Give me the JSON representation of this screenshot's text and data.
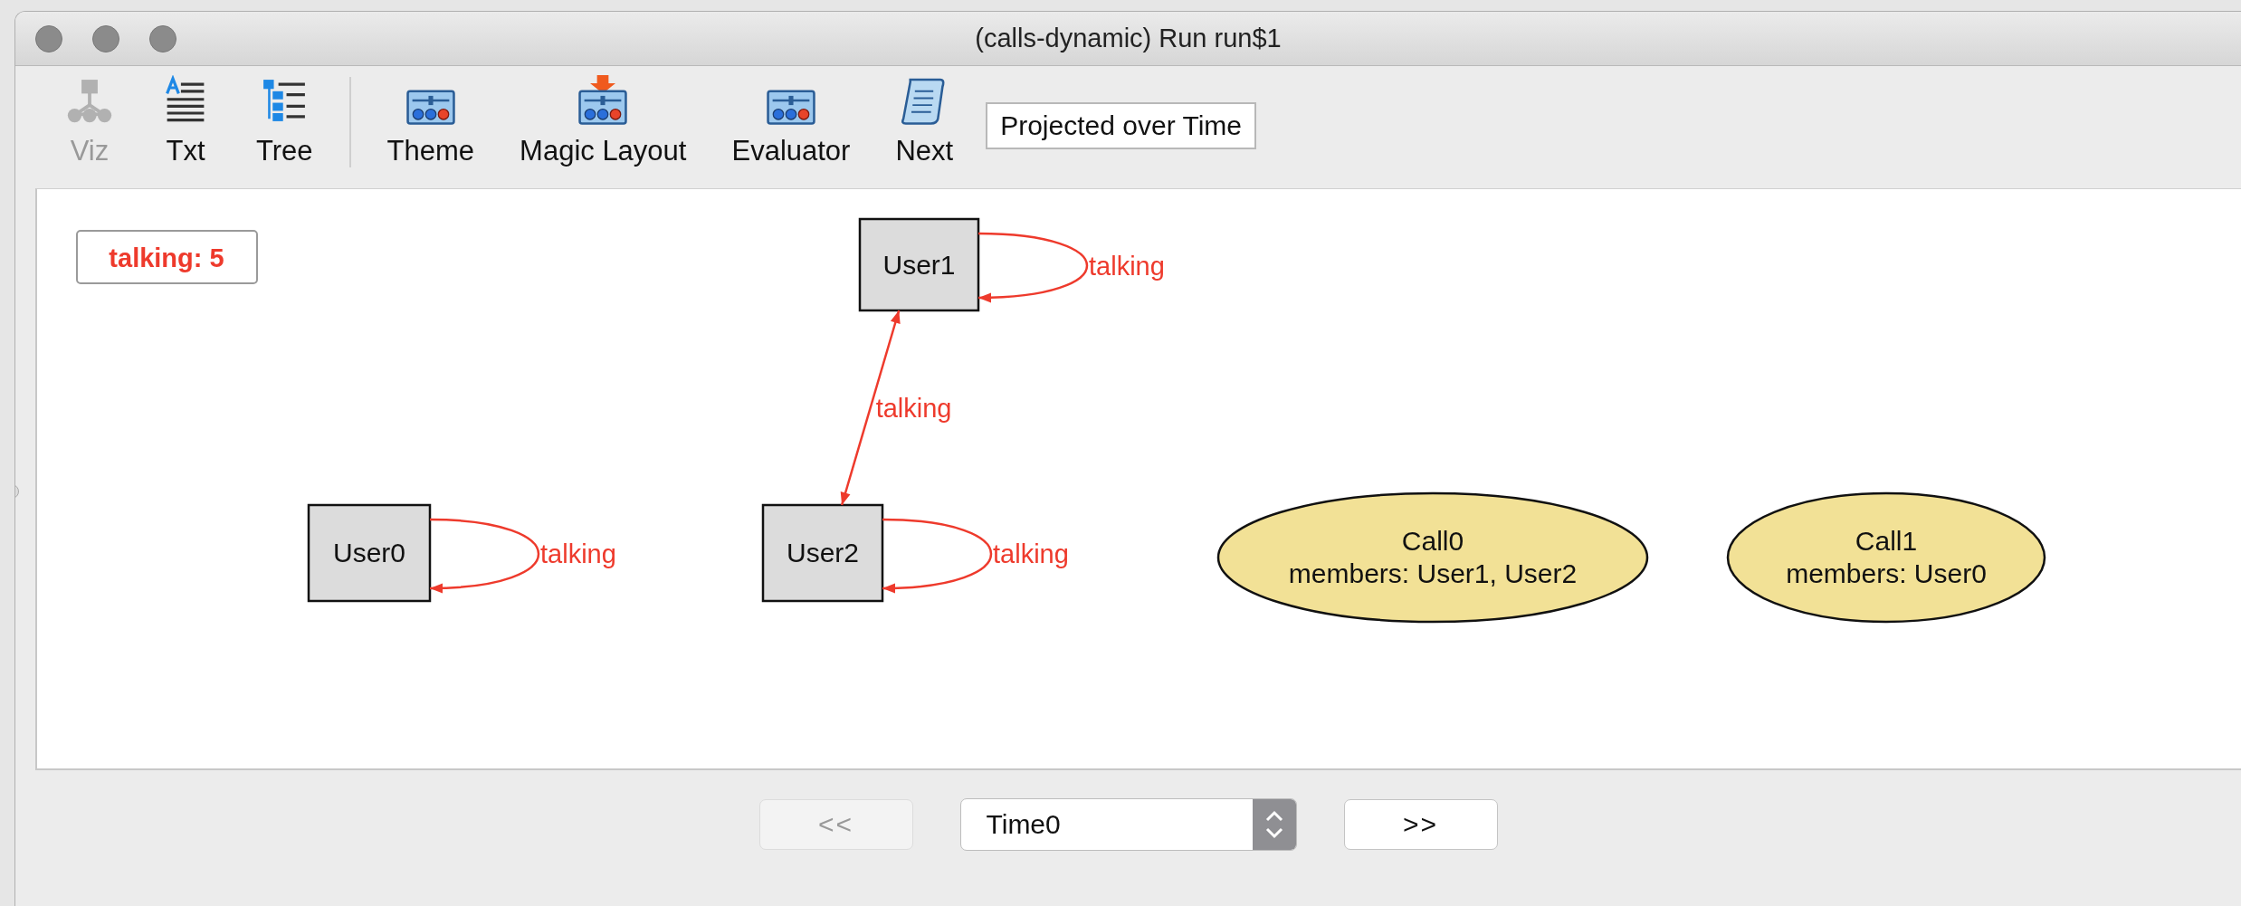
{
  "window": {
    "title": "(calls-dynamic) Run run$1"
  },
  "toolbar": {
    "view_buttons": [
      {
        "kind": "viz",
        "label": "Viz",
        "disabled": true
      },
      {
        "kind": "txt",
        "label": "Txt",
        "disabled": false
      },
      {
        "kind": "tree",
        "label": "Tree",
        "disabled": false
      }
    ],
    "action_buttons": [
      {
        "kind": "panel",
        "label": "Theme",
        "disabled": false
      },
      {
        "kind": "drop",
        "label": "Magic Layout",
        "disabled": false
      },
      {
        "kind": "panel",
        "label": "Evaluator",
        "disabled": false
      },
      {
        "kind": "scroll",
        "label": "Next",
        "disabled": false
      }
    ],
    "projection_button": {
      "label": "Projected over Time"
    }
  },
  "graph": {
    "legend": "talking: 5",
    "nodes": [
      {
        "kind": "box",
        "lines": [
          "User1"
        ]
      },
      {
        "kind": "box",
        "lines": [
          "User0"
        ]
      },
      {
        "kind": "box",
        "lines": [
          "User2"
        ]
      },
      {
        "kind": "ellipse",
        "lines": [
          "Call0",
          "members: User1, User2"
        ]
      },
      {
        "kind": "ellipse",
        "lines": [
          "Call1",
          "members: User0"
        ]
      }
    ],
    "edges": [
      {
        "kind": "loop",
        "label": "talking"
      },
      {
        "kind": "link",
        "label": "talking"
      },
      {
        "kind": "loop",
        "label": "talking"
      },
      {
        "kind": "loop",
        "label": "talking"
      }
    ]
  },
  "navigation": {
    "previous": {
      "label": "<<",
      "disabled": true
    },
    "time": {
      "value": "Time0"
    },
    "next": {
      "label": ">>",
      "disabled": false
    }
  }
}
